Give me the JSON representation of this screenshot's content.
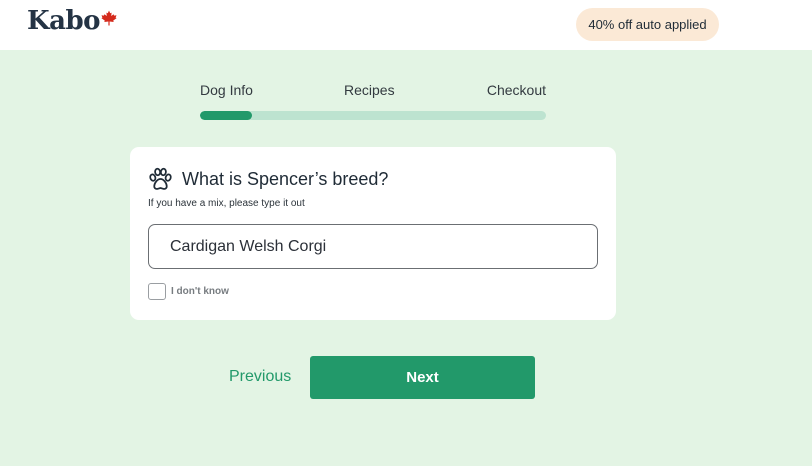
{
  "brand": {
    "name": "Kabo",
    "maple_icon": "maple-leaf-icon",
    "accent": "#22996a",
    "maple_color": "#d42a1c"
  },
  "header": {
    "promo_label": "40% off auto applied"
  },
  "steps": {
    "items": [
      "Dog Info",
      "Recipes",
      "Checkout"
    ],
    "progress_fraction": 0.15
  },
  "question": {
    "icon": "paw-icon",
    "title": "What is Spencer’s breed?",
    "hint": "If you have a mix, please type it out",
    "breed_value": "Cardigan Welsh Corgi",
    "dont_know_label": "I don't know",
    "dont_know_checked": false
  },
  "nav": {
    "previous_label": "Previous",
    "next_label": "Next"
  }
}
